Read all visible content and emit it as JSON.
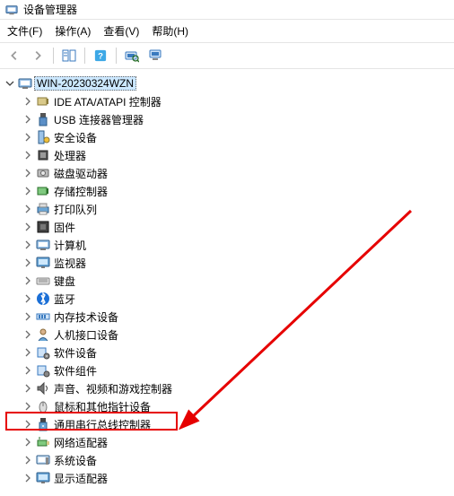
{
  "window": {
    "title": "设备管理器"
  },
  "menu": {
    "file": "文件(F)",
    "action": "操作(A)",
    "view": "查看(V)",
    "help": "帮助(H)"
  },
  "root": {
    "name": "WIN-20230324WZN"
  },
  "categories": [
    {
      "label": "IDE ATA/ATAPI 控制器",
      "icon": "ide"
    },
    {
      "label": "USB 连接器管理器",
      "icon": "usb"
    },
    {
      "label": "安全设备",
      "icon": "security"
    },
    {
      "label": "处理器",
      "icon": "cpu"
    },
    {
      "label": "磁盘驱动器",
      "icon": "disk"
    },
    {
      "label": "存储控制器",
      "icon": "storage"
    },
    {
      "label": "打印队列",
      "icon": "printer"
    },
    {
      "label": "固件",
      "icon": "firmware"
    },
    {
      "label": "计算机",
      "icon": "computer"
    },
    {
      "label": "监视器",
      "icon": "monitor"
    },
    {
      "label": "键盘",
      "icon": "keyboard"
    },
    {
      "label": "蓝牙",
      "icon": "bluetooth"
    },
    {
      "label": "内存技术设备",
      "icon": "memory"
    },
    {
      "label": "人机接口设备",
      "icon": "hid"
    },
    {
      "label": "软件设备",
      "icon": "software"
    },
    {
      "label": "软件组件",
      "icon": "component"
    },
    {
      "label": "声音、视频和游戏控制器",
      "icon": "sound"
    },
    {
      "label": "鼠标和其他指针设备",
      "icon": "mouse"
    },
    {
      "label": "通用串行总线控制器",
      "icon": "usbctrl"
    },
    {
      "label": "网络适配器",
      "icon": "network"
    },
    {
      "label": "系统设备",
      "icon": "system"
    },
    {
      "label": "显示适配器",
      "icon": "display"
    }
  ]
}
